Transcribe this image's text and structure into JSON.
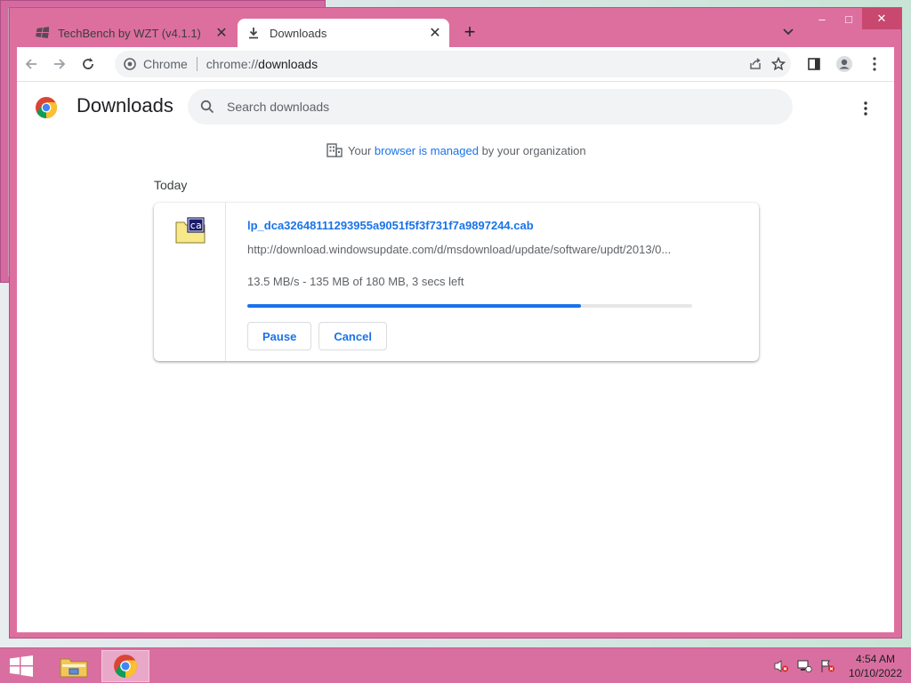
{
  "window": {
    "tabs": [
      {
        "label": "TechBench by WZT (v4.1.1)",
        "active": false
      },
      {
        "label": "Downloads",
        "active": true
      }
    ],
    "controls": {
      "minimize": "–",
      "maximize": "□",
      "close": "✕"
    }
  },
  "toolbar": {
    "site_label": "Chrome",
    "url_scheme": "chrome://",
    "url_host": "downloads"
  },
  "downloads_page": {
    "title": "Downloads",
    "search_placeholder": "Search downloads",
    "managed": {
      "prefix": "Your ",
      "link": "browser is managed",
      "suffix": " by your organization"
    },
    "day_label": "Today",
    "items": [
      {
        "file_name": "lp_dca32648111293955a9051f5f3f731f7a9897244.cab",
        "url": "http://download.windowsupdate.com/d/msdownload/update/software/updt/2013/0...",
        "status": "13.5 MB/s - 135 MB of 180 MB, 3 secs left",
        "progress": 0.75,
        "pause_label": "Pause",
        "cancel_label": "Cancel"
      }
    ]
  },
  "taskbar": {
    "time": "4:54 AM",
    "date": "10/10/2022"
  },
  "colors": {
    "window_frame": "#dd6f9f",
    "taskbar": "#d96fa1",
    "accent": "#1a73e8"
  }
}
